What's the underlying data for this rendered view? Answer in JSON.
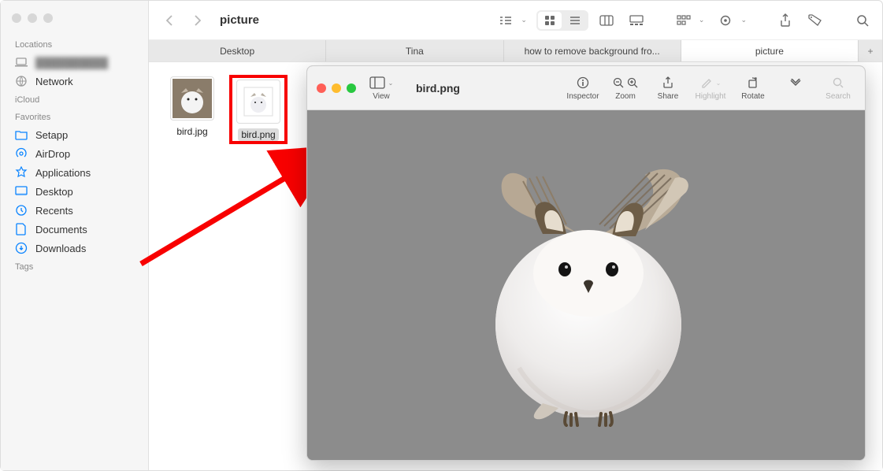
{
  "finder": {
    "title": "picture",
    "sidebar": {
      "sections": [
        {
          "label": "Locations",
          "items": [
            {
              "icon": "laptop",
              "label": "██████████",
              "blur": true
            },
            {
              "icon": "globe",
              "label": "Network"
            }
          ]
        },
        {
          "label": "iCloud",
          "items": []
        },
        {
          "label": "Favorites",
          "items": [
            {
              "icon": "folder",
              "label": "Setapp"
            },
            {
              "icon": "airdrop",
              "label": "AirDrop"
            },
            {
              "icon": "apps",
              "label": "Applications"
            },
            {
              "icon": "desktop",
              "label": "Desktop"
            },
            {
              "icon": "clock",
              "label": "Recents"
            },
            {
              "icon": "doc",
              "label": "Documents"
            },
            {
              "icon": "download",
              "label": "Downloads"
            }
          ]
        },
        {
          "label": "Tags",
          "items": []
        }
      ]
    },
    "tabs": [
      {
        "label": "Desktop",
        "active": false
      },
      {
        "label": "Tina",
        "active": false
      },
      {
        "label": "how to remove background fro...",
        "active": false
      },
      {
        "label": "picture",
        "active": true
      }
    ],
    "files": [
      {
        "name": "bird.jpg",
        "selected": false
      },
      {
        "name": "bird.png",
        "selected": true
      }
    ]
  },
  "preview": {
    "title": "bird.png",
    "toolbar": {
      "view": "View",
      "inspector": "Inspector",
      "zoom": "Zoom",
      "share": "Share",
      "highlight": "Highlight",
      "rotate": "Rotate",
      "search": "Search"
    }
  }
}
